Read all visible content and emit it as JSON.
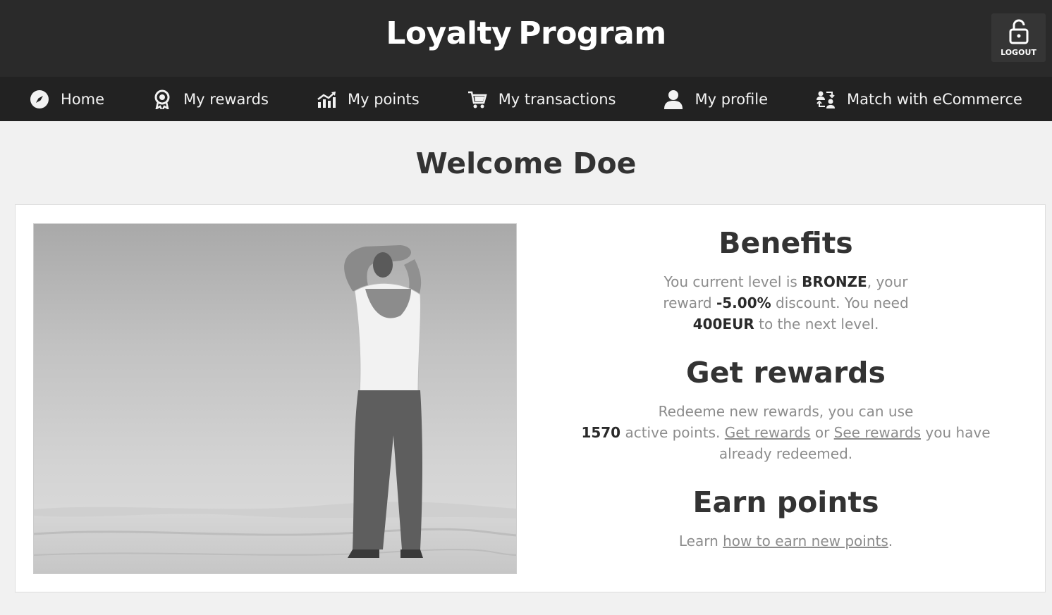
{
  "header": {
    "title_part1": "Loyalty",
    "title_part2": "Program",
    "logout_label": "LOGOUT",
    "logout_icon": "padlock-icon"
  },
  "nav": {
    "items": [
      {
        "label": "Home",
        "icon": "compass-icon"
      },
      {
        "label": "My rewards",
        "icon": "award-ribbon-icon"
      },
      {
        "label": "My points",
        "icon": "chart-up-icon"
      },
      {
        "label": "My transactions",
        "icon": "shopping-cart-icon"
      },
      {
        "label": "My profile",
        "icon": "user-icon"
      },
      {
        "label": "Match with eCommerce",
        "icon": "user-exchange-icon"
      }
    ]
  },
  "page": {
    "welcome": "Welcome Doe"
  },
  "benefits": {
    "title": "Benefits",
    "text1": "You current level is ",
    "level": "BRONZE",
    "text2": ", your reward ",
    "discount": "-5.00%",
    "text3": " discount.",
    "text4": "You need ",
    "needed": "400EUR",
    "text5": " to the next level."
  },
  "rewards": {
    "title": "Get rewards",
    "text1": "Redeeme new rewards, you can use",
    "points": "1570",
    "text2": " active points. ",
    "get_link": "Get rewards",
    "text3": " or ",
    "see_link": "See rewards",
    "text4": " you have already redeemed."
  },
  "earn": {
    "title": "Earn points",
    "text1": "Learn ",
    "link": "how to earn new points",
    "text2": "."
  }
}
